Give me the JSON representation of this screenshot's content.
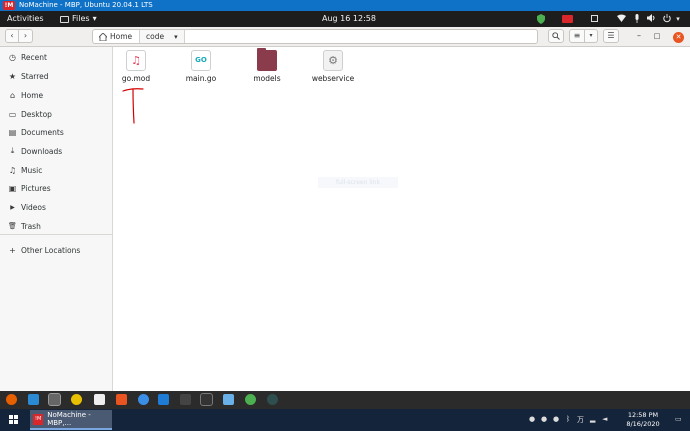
{
  "nomachine": {
    "logo": "!M",
    "title": "NoMachine - MBP, Ubuntu 20.04.1 LTS"
  },
  "topbar": {
    "activities": "Activities",
    "app_menu": "Files",
    "app_menu_arrow": "▾",
    "clock": "Aug 16  12:58",
    "tray_arrow": "▾"
  },
  "header": {
    "back": "‹",
    "forward": "›",
    "breadcrumbs": [
      {
        "label": "Home",
        "icon": "home-icon"
      },
      {
        "label": "code",
        "icon": "chevron-down-icon"
      }
    ],
    "crumb_arrow": "▾",
    "search_glyph": "⌕",
    "view_list_glyph": "≡",
    "view_menu_glyph": "▾",
    "menu_glyph": "☰",
    "minimize": "–",
    "maximize": "□",
    "close": "✕"
  },
  "sidebar": {
    "items": [
      {
        "label": "Recent",
        "glyph": "◷"
      },
      {
        "label": "Starred",
        "glyph": "★"
      },
      {
        "label": "Home",
        "glyph": "⌂"
      },
      {
        "label": "Desktop",
        "glyph": "▭"
      },
      {
        "label": "Documents",
        "glyph": "▤"
      },
      {
        "label": "Downloads",
        "glyph": "⤓"
      },
      {
        "label": "Music",
        "glyph": "♫"
      },
      {
        "label": "Pictures",
        "glyph": "▣"
      },
      {
        "label": "Videos",
        "glyph": "▶"
      },
      {
        "label": "Trash",
        "glyph": "🗑"
      }
    ],
    "other_locations": {
      "label": "Other Locations",
      "glyph": "+"
    }
  },
  "files": [
    {
      "name": "go.mod",
      "icon": "music-file-icon",
      "glyph": "♫"
    },
    {
      "name": "main.go",
      "icon": "go-file-icon",
      "glyph": "GO"
    },
    {
      "name": "models",
      "icon": "folder-icon",
      "glyph": ""
    },
    {
      "name": "webservice",
      "icon": "executable-icon",
      "glyph": "⚙"
    }
  ],
  "overlay_label": "full-screen link",
  "windows_taskbar": {
    "task_logo": "!M",
    "task_label": "NoMachine - MBP,...",
    "time": "12:58 PM",
    "date": "8/16/2020",
    "ime": "万"
  },
  "colors": {
    "title_bar": "#0f72c7",
    "top_bar": "#1d1d1d",
    "close_button": "#e95420",
    "folder": "#8a3b4c",
    "annotation_red": "#d40000",
    "win_taskbar": "#14243a"
  }
}
